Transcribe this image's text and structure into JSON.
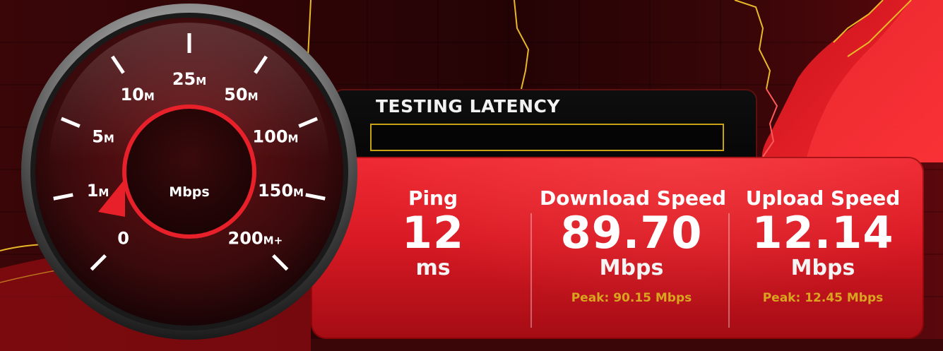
{
  "latency": {
    "title": "TESTING LATENCY"
  },
  "gauge": {
    "unit": "Mbps",
    "ticks": [
      {
        "num": "0",
        "suffix": ""
      },
      {
        "num": "1",
        "suffix": "M"
      },
      {
        "num": "5",
        "suffix": "M"
      },
      {
        "num": "10",
        "suffix": "M"
      },
      {
        "num": "25",
        "suffix": "M"
      },
      {
        "num": "50",
        "suffix": "M"
      },
      {
        "num": "100",
        "suffix": "M"
      },
      {
        "num": "150",
        "suffix": "M"
      },
      {
        "num": "200",
        "suffix": "M+"
      }
    ]
  },
  "ping": {
    "label": "Ping",
    "value": "12",
    "unit": "ms"
  },
  "download": {
    "label": "Download Speed",
    "value": "89.70",
    "unit": "Mbps",
    "peak": "Peak: 90.15 Mbps"
  },
  "upload": {
    "label": "Upload Speed",
    "value": "12.14",
    "unit": "Mbps",
    "peak": "Peak: 12.45 Mbps"
  },
  "colors": {
    "accent": "#e8202a",
    "peak": "#d9a520",
    "map_border": "#e8b828",
    "background": "#2a0406"
  }
}
